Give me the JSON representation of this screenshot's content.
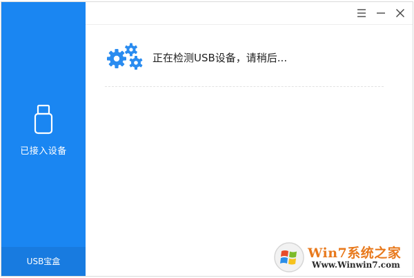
{
  "sidebar": {
    "item": {
      "label": "已接入设备",
      "icon": "usb-drive-icon"
    },
    "footer": {
      "label": "USB宝盒"
    },
    "color": "#1a86f2"
  },
  "titlebar": {
    "buttons": [
      "menu-icon",
      "minimize-icon",
      "close-icon"
    ]
  },
  "status": {
    "icon": "gears-icon",
    "text": "正在检测USB设备，请稍后...",
    "icon_color": "#2a8cf0"
  },
  "watermark": {
    "brand": "Win7系统之家",
    "url": "Www.Winwin7.com"
  }
}
